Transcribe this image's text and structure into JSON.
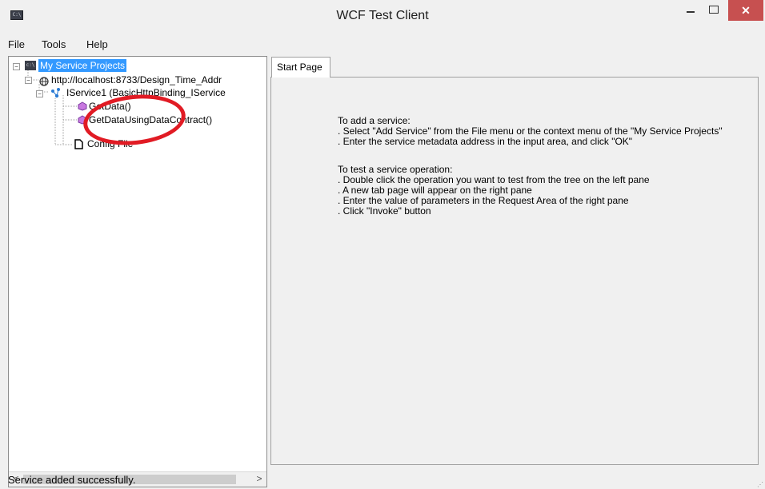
{
  "window": {
    "title": "WCF Test Client",
    "app_icon_text": "C:\\",
    "close_glyph": "✕"
  },
  "menu": [
    "File",
    "Tools",
    "Help"
  ],
  "tree": {
    "root_icon_text": "c:\\",
    "root": "My Service Projects",
    "endpoint": "http://localhost:8733/Design_Time_Addr",
    "contract": "IService1 (BasicHttpBinding_IService",
    "op1": "GetData()",
    "op2": "GetDataUsingDataContract()",
    "config": "Config File"
  },
  "tabs": [
    "Start Page"
  ],
  "instructions": {
    "l1": "To add a service:",
    "l2": ". Select \"Add Service\" from the File menu or the context menu of the \"My Service Projects\"",
    "l3": ". Enter the service metadata address in the input area, and click \"OK\"",
    "l4": "To test a service operation:",
    "l5": ". Double click the operation you want to test from the tree on the left pane",
    "l6": ". A new tab page will appear on the right pane",
    "l7": ". Enter the value of parameters in the Request Area of the right pane",
    "l8": ". Click \"Invoke\" button"
  },
  "scroll": {
    "left_arrow": "<",
    "right_arrow": ">"
  },
  "status": "Service added successfully.",
  "colors": {
    "selection": "#3399ff",
    "highlight_oval": "#e11b24",
    "close_button": "#c75050"
  }
}
